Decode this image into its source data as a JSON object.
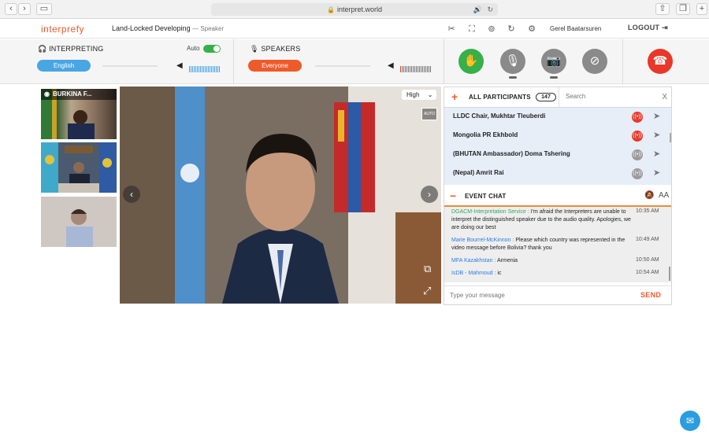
{
  "browser": {
    "url": "interpret.world",
    "back": "‹",
    "forward": "›"
  },
  "header": {
    "logo": "interprefy",
    "event_title": "Land-Locked Developing",
    "role": "— Speaker",
    "user_name": "Gerel Baatarsuren",
    "logout_label": "LOGOUT"
  },
  "interpreting": {
    "label": "INTERPRETING",
    "auto_label": "Auto",
    "auto_enabled": true,
    "language": "English",
    "language_color": "#4aa6e3"
  },
  "speakers": {
    "label": "SPEAKERS",
    "selection": "Everyone",
    "selection_color": "#ef5a2a"
  },
  "thumbnails": [
    {
      "label": "BURKINA F..."
    },
    {
      "label": ""
    },
    {
      "label": ""
    }
  ],
  "video": {
    "quality": "High",
    "auto_badge": "AUTO"
  },
  "participants": {
    "title": "ALL PARTICIPANTS",
    "count": "147",
    "search_placeholder": "Search",
    "close": "X",
    "items": [
      {
        "name": "LLDC Chair, Mukhtar Tleuberdi",
        "status": "speaking"
      },
      {
        "name": "Mongolia PR Ekhbold",
        "status": "speaking"
      },
      {
        "name": "(BHUTAN Ambassador) Doma Tshering",
        "status": "idle"
      },
      {
        "name": "(Nepal) Amrit Rai",
        "status": "idle"
      }
    ]
  },
  "chat": {
    "title": "EVENT CHAT",
    "font_toggle": "AA",
    "messages": [
      {
        "from": "DGACM-Interpretation Service :",
        "text": "I'm afraid the Interpreters are unable to interpret the distinguished speaker due to the audio quality. Apologies, we are doing our best",
        "time": "10:35 AM"
      },
      {
        "from": "Marie Bourrel-McKinnon :",
        "text": "Please which country was represented in the video message before Bolivia? thank you",
        "time": "10:49 AM"
      },
      {
        "from": "MFA Kazakhstan :",
        "text": "Armenia",
        "time": "10:50 AM"
      },
      {
        "from": "IsDB - Mahmoud :",
        "text": "ic",
        "time": "10:54 AM"
      }
    ],
    "compose_placeholder": "Type your message",
    "send_label": "SEND"
  },
  "colors": {
    "brand": "#ef5a2a",
    "accent_blue": "#4aa6e3",
    "hand_green": "#36b04a",
    "hangup_red": "#e8382a"
  }
}
